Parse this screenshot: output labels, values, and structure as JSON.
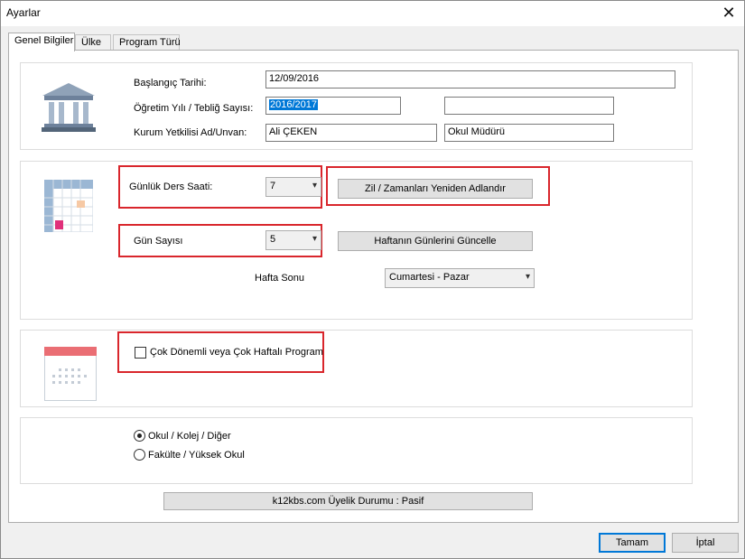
{
  "window": {
    "title": "Ayarlar",
    "close_glyph": "✕"
  },
  "tabs": [
    {
      "label": "Genel Bilgiler",
      "active": true
    },
    {
      "label": "Ülke",
      "active": false
    },
    {
      "label": "Program Türü",
      "active": false
    }
  ],
  "general": {
    "start_date_label": "Başlangıç Tarihi:",
    "start_date_value": "12/09/2016",
    "year_label": "Öğretim Yılı / Tebliğ Sayısı:",
    "year_value": "2016/2017",
    "circular_value": "",
    "official_label": "Kurum Yetkilisi Ad/Unvan:",
    "official_name": "Ali ÇEKEN",
    "official_title": "Okul Müdürü"
  },
  "schedule": {
    "daily_hours_label": "Günlük Ders Saati:",
    "daily_hours_value": "7",
    "rename_bells_button": "Zil / Zamanları Yeniden Adlandır",
    "days_label": "Gün Sayısı",
    "days_value": "5",
    "update_days_button": "Haftanın Günlerini Güncelle",
    "weekend_label": "Hafta Sonu",
    "weekend_value": "Cumartesi - Pazar"
  },
  "multi_term": {
    "checkbox_label": "Çok Dönemli veya Çok Haftalı Program",
    "checked": false
  },
  "institution_type": {
    "options": [
      {
        "label": "Okul / Kolej / Diğer",
        "selected": true
      },
      {
        "label": "Fakülte / Yüksek Okul",
        "selected": false
      }
    ]
  },
  "membership_status": "k12kbs.com Üyelik Durumu : Pasif",
  "footer": {
    "ok_button": "Tamam",
    "cancel_button": "İptal"
  },
  "colors": {
    "highlight_red": "#d9262c",
    "selection_blue": "#0078d7"
  }
}
